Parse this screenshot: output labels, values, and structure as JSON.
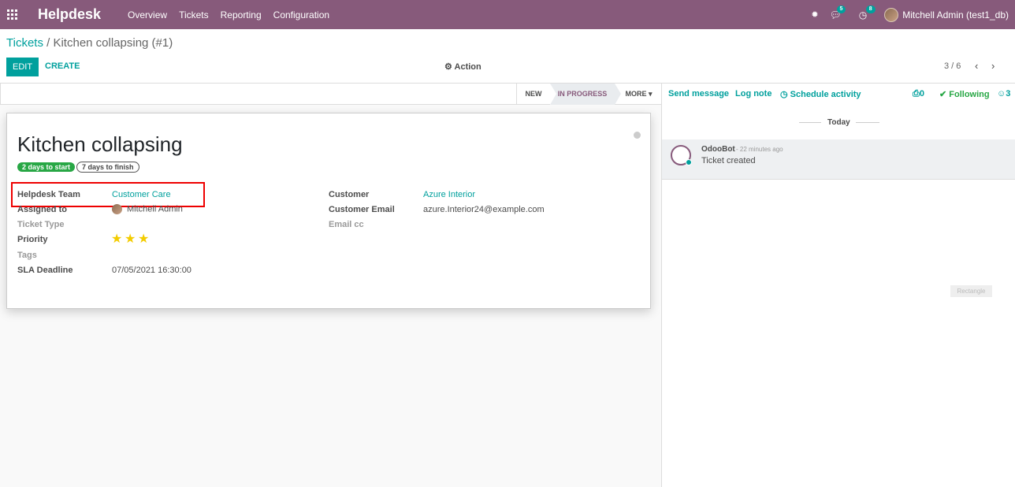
{
  "nav": {
    "brand": "Helpdesk",
    "menu": [
      "Overview",
      "Tickets",
      "Reporting",
      "Configuration"
    ],
    "messages_count": "5",
    "activities_count": "8",
    "user": "Mitchell Admin (test1_db)"
  },
  "control": {
    "breadcrumb_root": "Tickets",
    "breadcrumb_sep": "/",
    "breadcrumb_current": "Kitchen collapsing (#1)",
    "edit_label": "EDIT",
    "create_label": "CREATE",
    "action_label": "Action",
    "pager": "3 / 6"
  },
  "stages": {
    "new": "NEW",
    "in_progress": "IN PROGRESS",
    "more": "MORE"
  },
  "ticket": {
    "title": "Kitchen collapsing",
    "tag_start": "2 days to start",
    "tag_finish": "7 days to finish",
    "labels": {
      "team": "Helpdesk Team",
      "assigned": "Assigned to",
      "type": "Ticket Type",
      "priority": "Priority",
      "tags": "Tags",
      "sla": "SLA Deadline",
      "customer": "Customer",
      "customer_email": "Customer Email",
      "email_cc": "Email cc"
    },
    "values": {
      "team": "Customer Care",
      "assigned": "Mitchell Admin",
      "priority_stars": 3,
      "sla": "07/05/2021 16:30:00",
      "customer": "Azure Interior",
      "customer_email": "azure.Interior24@example.com"
    }
  },
  "chatter": {
    "send_message": "Send message",
    "log_note": "Log note",
    "schedule_activity": "Schedule activity",
    "attachments": "0",
    "following": "Following",
    "followers": "3",
    "date_separator": "Today",
    "message": {
      "author": "OdooBot",
      "time": "- 22 minutes ago",
      "body": "Ticket created"
    },
    "rectangle_label": "Rectangle"
  },
  "colors": {
    "brand": "#875a7b",
    "accent": "#00a09d",
    "star": "#f3cc00",
    "highlight": "#e00000"
  }
}
